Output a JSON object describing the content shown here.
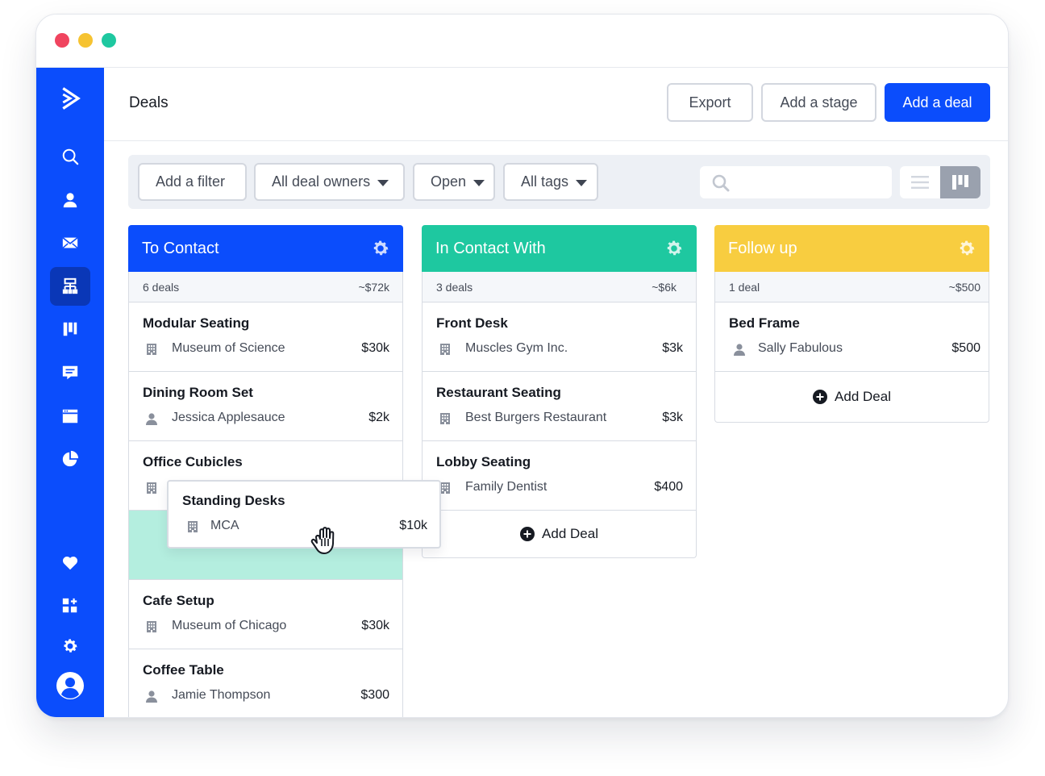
{
  "page": {
    "title": "Deals"
  },
  "header": {
    "export_label": "Export",
    "add_stage_label": "Add a stage",
    "add_deal_label": "Add a deal"
  },
  "filters": {
    "add_filter": "Add a filter",
    "owners": "All deal owners",
    "status": "Open",
    "tags": "All tags",
    "search_placeholder": ""
  },
  "sidebar": {
    "items": [
      "logo-icon",
      "search-icon",
      "contacts-icon",
      "email-icon",
      "deals-icon",
      "pipeline-icon",
      "conversations-icon",
      "site-icon",
      "reports-icon",
      "heart-icon",
      "apps-icon",
      "gear-icon",
      "account-icon"
    ],
    "active": "deals-icon"
  },
  "colors": {
    "brand": "#0b4dfc",
    "to_contact": "#0b4dfc",
    "in_contact": "#1ec8a0",
    "follow_up": "#f8cd40",
    "drop_zone": "#b4eedf"
  },
  "columns": [
    {
      "title": "To Contact",
      "count": "6 deals",
      "total": "~$72k",
      "cards": [
        {
          "title": "Modular Seating",
          "icon": "building-icon",
          "org": "Museum of Science",
          "value": "$30k"
        },
        {
          "title": "Dining Room Set",
          "icon": "person-icon",
          "org": "Jessica Applesauce",
          "value": "$2k"
        },
        {
          "title": "Office Cubicles",
          "icon": "building-icon",
          "org": "",
          "value": ""
        },
        {
          "title": "Cafe Setup",
          "icon": "building-icon",
          "org": "Museum of Chicago",
          "value": "$30k"
        },
        {
          "title": "Coffee Table",
          "icon": "person-icon",
          "org": "Jamie Thompson",
          "value": "$300"
        }
      ]
    },
    {
      "title": "In Contact With",
      "count": "3 deals",
      "total": "~$6k",
      "cards": [
        {
          "title": "Front Desk",
          "icon": "building-icon",
          "org": "Muscles Gym Inc.",
          "value": "$3k"
        },
        {
          "title": "Restaurant Seating",
          "icon": "building-icon",
          "org": "Best Burgers Restaurant",
          "value": "$3k"
        },
        {
          "title": "Lobby Seating",
          "icon": "building-icon",
          "org": "Family Dentist",
          "value": "$400"
        }
      ],
      "add_label": "Add Deal"
    },
    {
      "title": "Follow up",
      "count": "1 deal",
      "total": "~$500",
      "cards": [
        {
          "title": "Bed Frame",
          "icon": "person-icon",
          "org": "Sally Fabulous",
          "value": "$500"
        }
      ],
      "add_label": "Add Deal"
    }
  ],
  "dragging_card": {
    "title": "Standing Desks",
    "icon": "building-icon",
    "org": "MCA",
    "value": "$10k"
  }
}
